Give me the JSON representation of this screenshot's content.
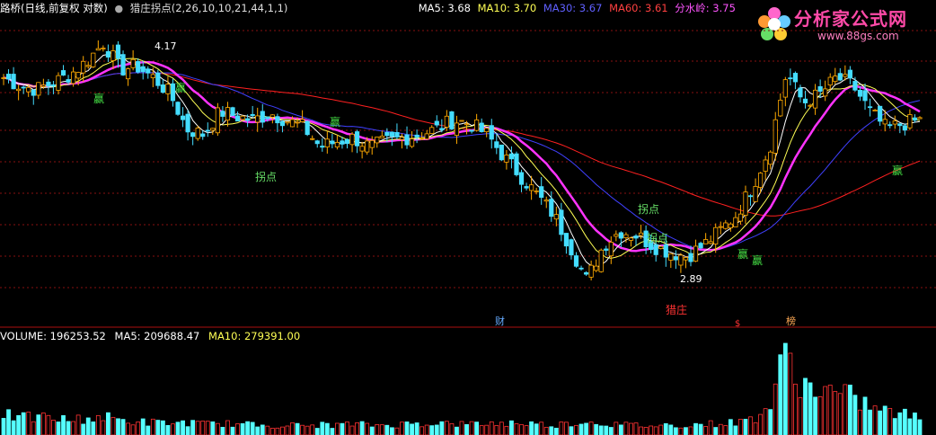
{
  "header": {
    "stock_title": "路桥(日线,前复权 对数)",
    "circle_icon": "●",
    "indicator": "猎庄拐点(2,26,10,10,21,44,1,1)",
    "ma5": "MA5: 3.68",
    "ma10": "MA10: 3.70",
    "ma30": "MA30: 3.67",
    "ma60": "MA60: 3.61",
    "fsl": "分水岭: 3.75"
  },
  "logo": {
    "name": "分析家公式网",
    "url": "www.88gs.com"
  },
  "volume_header": {
    "volume": "VOLUME: 196253.52",
    "ma5": "MA5: 209688.47",
    "ma10": "MA10: 279391.00"
  },
  "colors": {
    "background": "#000000",
    "up_candle": "#ffaa00",
    "down_candle": "#44ddff",
    "ma5": "#ffffff",
    "ma10": "#ffff55",
    "ma30": "#4040ff",
    "ma60": "#ff2020",
    "fenshuiling": "#ff33ff",
    "grid": "#881111",
    "volume_up": "#ff3333",
    "volume_down": "#55ffff"
  },
  "chart_data": {
    "type": "candlestick",
    "price_high_label": "4.17",
    "price_low_label": "2.89",
    "annotations": {
      "win": "赢",
      "turn": "拐点",
      "hunt": "猎庄",
      "cai": "财",
      "bang": "榜",
      "s_mark": "$"
    },
    "price_trend": [
      3.95,
      3.9,
      3.88,
      3.92,
      3.97,
      4.05,
      4.17,
      4.0,
      4.02,
      3.95,
      3.85,
      3.65,
      3.62,
      3.75,
      3.72,
      3.7,
      3.74,
      3.7,
      3.66,
      3.55,
      3.58,
      3.6,
      3.55,
      3.58,
      3.6,
      3.62,
      3.65,
      3.7,
      3.68,
      3.62,
      3.5,
      3.4,
      3.3,
      3.2,
      3.05,
      2.89,
      3.05,
      3.12,
      3.1,
      3.05,
      3.02,
      3.0,
      3.05,
      3.12,
      3.2,
      3.35,
      3.55,
      3.98,
      3.8,
      3.85,
      3.95,
      3.9,
      3.75,
      3.65,
      3.68,
      3.7
    ],
    "volume_trend": [
      0.25,
      0.2,
      0.22,
      0.2,
      0.18,
      0.2,
      0.22,
      0.18,
      0.16,
      0.15,
      0.14,
      0.15,
      0.13,
      0.14,
      0.13,
      0.12,
      0.12,
      0.12,
      0.11,
      0.12,
      0.12,
      0.13,
      0.12,
      0.12,
      0.13,
      0.14,
      0.15,
      0.13,
      0.13,
      0.14,
      0.14,
      0.15,
      0.13,
      0.12,
      0.14,
      0.16,
      0.14,
      0.12,
      0.12,
      0.11,
      0.12,
      0.12,
      0.13,
      0.14,
      0.15,
      0.2,
      0.35,
      1.0,
      0.6,
      0.55,
      0.5,
      0.45,
      0.35,
      0.28,
      0.25,
      0.2
    ]
  }
}
